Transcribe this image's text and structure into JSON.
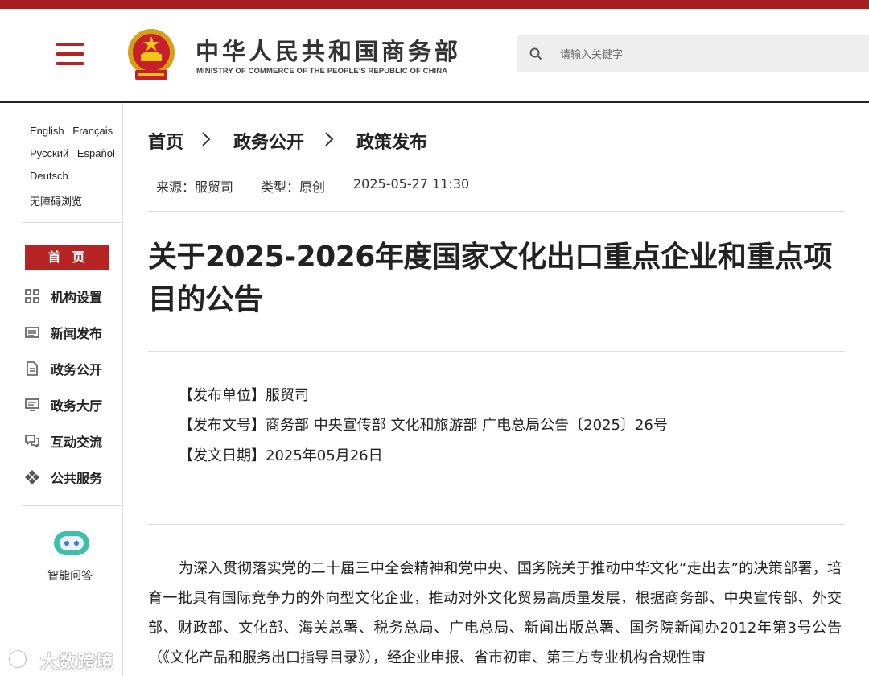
{
  "header": {
    "title": "中华人民共和国商务部",
    "subtitle": "MINISTRY OF COMMERCE OF THE PEOPLE'S REPUBLIC OF CHINA",
    "search_placeholder": "请输入关键字"
  },
  "sidebar": {
    "languages_row1": [
      "English",
      "Français"
    ],
    "languages_row2": [
      "Русский",
      "Español"
    ],
    "languages_row3": [
      "Deutsch"
    ],
    "accessibility": "无障碍浏览",
    "home": "首页",
    "nav": [
      {
        "label": "机构设置",
        "icon": "grid-icon"
      },
      {
        "label": "新闻发布",
        "icon": "newspaper-icon"
      },
      {
        "label": "政务公开",
        "icon": "document-icon"
      },
      {
        "label": "政务大厅",
        "icon": "monitor-icon"
      },
      {
        "label": "互动交流",
        "icon": "chat-icon"
      },
      {
        "label": "公共服务",
        "icon": "service-icon"
      }
    ],
    "ai_label": "智能问答"
  },
  "breadcrumb": [
    "首页",
    "政务公开",
    "政策发布"
  ],
  "meta": {
    "source": "来源：服贸司",
    "type": "类型：原创",
    "datetime": "2025-05-27 11:30"
  },
  "article": {
    "title": "关于2025-2026年度国家文化出口重点企业和重点项目的公告",
    "issuer": "【发布单位】服贸司",
    "doc_no": "【发布文号】商务部 中央宣传部 文化和旅游部 广电总局公告〔2025〕26号",
    "date": "【发文日期】2025年05月26日",
    "body": "为深入贯彻落实党的二十届三中全会精神和党中央、国务院关于推动中华文化“走出去”的决策部署，培育一批具有国际竞争力的外向型文化企业，推动对外文化贸易高质量发展，根据商务部、中央宣传部、外交部、财政部、文化部、海关总署、税务总局、广电总局、新闻出版总署、国务院新闻办2012年第3号公告（《文化产品和服务出口指导目录》），经企业申报、省市初审、第三方专业机构合规性审"
  },
  "watermark": "大数跨境",
  "colors": {
    "accent": "#b52323",
    "topbar": "#a51d1d",
    "search_bg": "#eeeeee"
  }
}
